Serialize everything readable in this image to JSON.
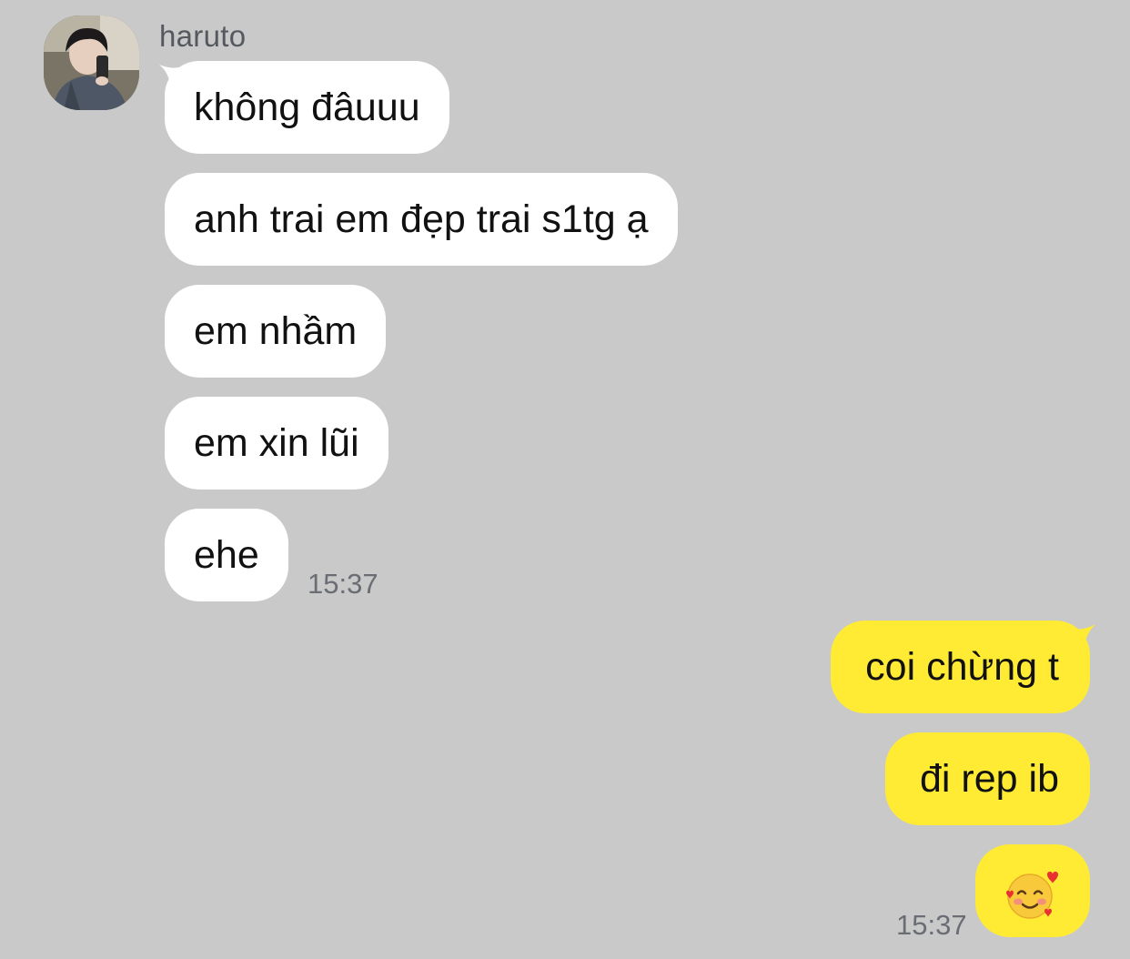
{
  "thread": {
    "sender_name": "haruto",
    "avatar_icon": "contact-avatar-photo-icon",
    "incoming_color": "#ffffff",
    "outgoing_color": "#ffeb34",
    "background_color": "#c9c9c9",
    "incoming": [
      {
        "text": "không đâuuu"
      },
      {
        "text": "anh trai em đẹp trai s1tg ạ"
      },
      {
        "text": "em nhầm"
      },
      {
        "text": "em xin lũi"
      },
      {
        "text": "ehe"
      }
    ],
    "incoming_time": "15:37",
    "outgoing": [
      {
        "text": "coi chừng t"
      },
      {
        "text": "đi rep ib"
      },
      {
        "emoji": "smiling-face-with-hearts-icon"
      }
    ],
    "outgoing_time": "15:37"
  }
}
